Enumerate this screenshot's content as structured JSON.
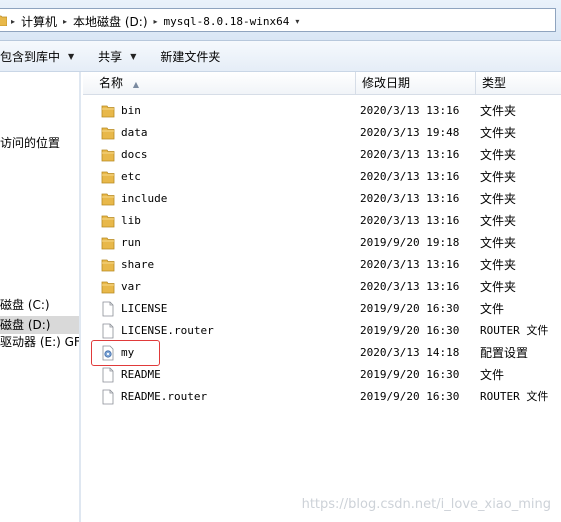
{
  "address": {
    "crumbs": [
      "计算机",
      "本地磁盘 (D:)",
      "mysql-8.0.18-winx64"
    ]
  },
  "toolbar": {
    "include_label": "包含到库中",
    "share_label": "共享",
    "new_folder_label": "新建文件夹"
  },
  "nav": {
    "recent_label": "访问的位置",
    "drive_c_label": "磁盘 (C:)",
    "drive_d_label": "磁盘 (D:)",
    "drive_e_label": "驱动器 (E:) GF"
  },
  "columns": {
    "name": "名称",
    "date": "修改日期",
    "type": "类型"
  },
  "files": [
    {
      "name": "bin",
      "date": "2020/3/13 13:16",
      "type": "文件夹",
      "icon": "folder-icon"
    },
    {
      "name": "data",
      "date": "2020/3/13 19:48",
      "type": "文件夹",
      "icon": "folder-icon"
    },
    {
      "name": "docs",
      "date": "2020/3/13 13:16",
      "type": "文件夹",
      "icon": "folder-icon"
    },
    {
      "name": "etc",
      "date": "2020/3/13 13:16",
      "type": "文件夹",
      "icon": "folder-icon"
    },
    {
      "name": "include",
      "date": "2020/3/13 13:16",
      "type": "文件夹",
      "icon": "folder-icon"
    },
    {
      "name": "lib",
      "date": "2020/3/13 13:16",
      "type": "文件夹",
      "icon": "folder-icon"
    },
    {
      "name": "run",
      "date": "2019/9/20 19:18",
      "type": "文件夹",
      "icon": "folder-icon"
    },
    {
      "name": "share",
      "date": "2020/3/13 13:16",
      "type": "文件夹",
      "icon": "folder-icon"
    },
    {
      "name": "var",
      "date": "2020/3/13 13:16",
      "type": "文件夹",
      "icon": "folder-icon"
    },
    {
      "name": "LICENSE",
      "date": "2019/9/20 16:30",
      "type": "文件",
      "icon": "file-icon"
    },
    {
      "name": "LICENSE.router",
      "date": "2019/9/20 16:30",
      "type": "ROUTER 文件",
      "icon": "file-icon"
    },
    {
      "name": "my",
      "date": "2020/3/13 14:18",
      "type": "配置设置",
      "icon": "config-file-icon"
    },
    {
      "name": "README",
      "date": "2019/9/20 16:30",
      "type": "文件",
      "icon": "file-icon"
    },
    {
      "name": "README.router",
      "date": "2019/9/20 16:30",
      "type": "ROUTER 文件",
      "icon": "file-icon"
    }
  ],
  "watermark": "https://blog.csdn.net/i_love_xiao_ming",
  "colors": {
    "folder": "#e8b84a",
    "highlight": "#e03a3a"
  }
}
